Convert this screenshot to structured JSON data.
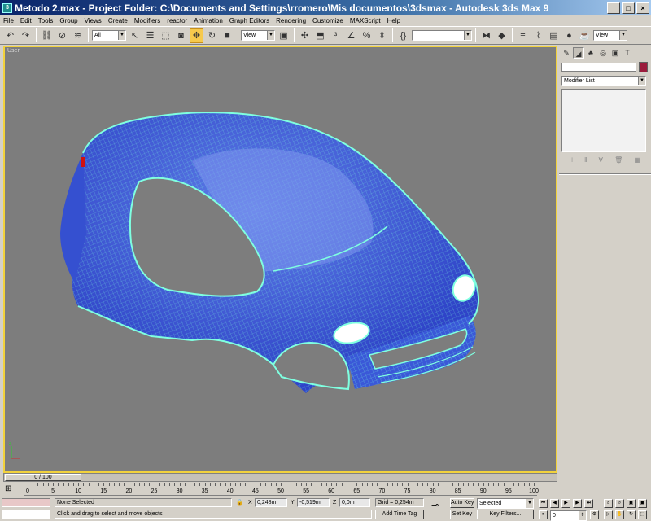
{
  "window": {
    "title": "Metodo 2.max   - Project Folder: C:\\Documents and Settings\\rromero\\Mis documentos\\3dsmax    - Autodesk 3ds Max 9",
    "minimize": "_",
    "maximize": "□",
    "close": "×",
    "app_icon": "3ds-max-icon"
  },
  "menu": [
    "File",
    "Edit",
    "Tools",
    "Group",
    "Views",
    "Create",
    "Modifiers",
    "reactor",
    "Animation",
    "Graph Editors",
    "Rendering",
    "Customize",
    "MAXScript",
    "Help"
  ],
  "toolbar": {
    "selection_filter": "All",
    "reference_coord": "View",
    "named_selection": "",
    "view_dropdown_right": "View",
    "icons": [
      "undo-icon",
      "redo-icon",
      "select-link-icon",
      "unlink-icon",
      "bind-spacewarp-icon",
      "select-object-icon",
      "select-by-name-icon",
      "rect-selection-icon",
      "window-crossing-icon",
      "select-move-icon",
      "select-rotate-icon",
      "select-scale-icon",
      "pivot-icon",
      "manipulate-icon",
      "snaps-icon",
      "angle-snap-icon",
      "percent-snap-icon",
      "spinner-snap-icon",
      "edit-named-sel-icon",
      "mirror-icon",
      "align-icon",
      "layer-manager-icon",
      "curve-editor-icon",
      "schematic-view-icon",
      "material-editor-icon",
      "render-scene-icon",
      "quick-render-icon"
    ]
  },
  "viewport": {
    "label": "User",
    "wire_color": "#7fffe0",
    "body_color": "#3d5bd9"
  },
  "command_panel": {
    "tabs": [
      "create-tab-icon",
      "modify-tab-icon",
      "hierarchy-tab-icon",
      "motion-tab-icon",
      "display-tab-icon",
      "utilities-tab-icon"
    ],
    "object_name": "",
    "object_color": "#9b1b3c",
    "modifier_list": "Modifier List"
  },
  "timeline": {
    "slider": "0 / 100",
    "ticks": [
      "0",
      "5",
      "10",
      "15",
      "20",
      "25",
      "30",
      "35",
      "40",
      "45",
      "50",
      "55",
      "60",
      "65",
      "70",
      "75",
      "80",
      "85",
      "90",
      "95",
      "100"
    ]
  },
  "status": {
    "selection": "None Selected",
    "prompt": "Click and drag to select and move objects",
    "x_label": "X",
    "x_value": "0,248m",
    "y_label": "Y",
    "y_value": "-0,519m",
    "z_label": "Z",
    "z_value": "0,0m",
    "grid": "Grid = 0,254m",
    "add_time_tag": "Add Time Tag",
    "auto_key": "Auto Key",
    "set_key": "Set Key",
    "key_mode": "Selected",
    "key_filters": "Key Filters...",
    "frame": "0"
  }
}
